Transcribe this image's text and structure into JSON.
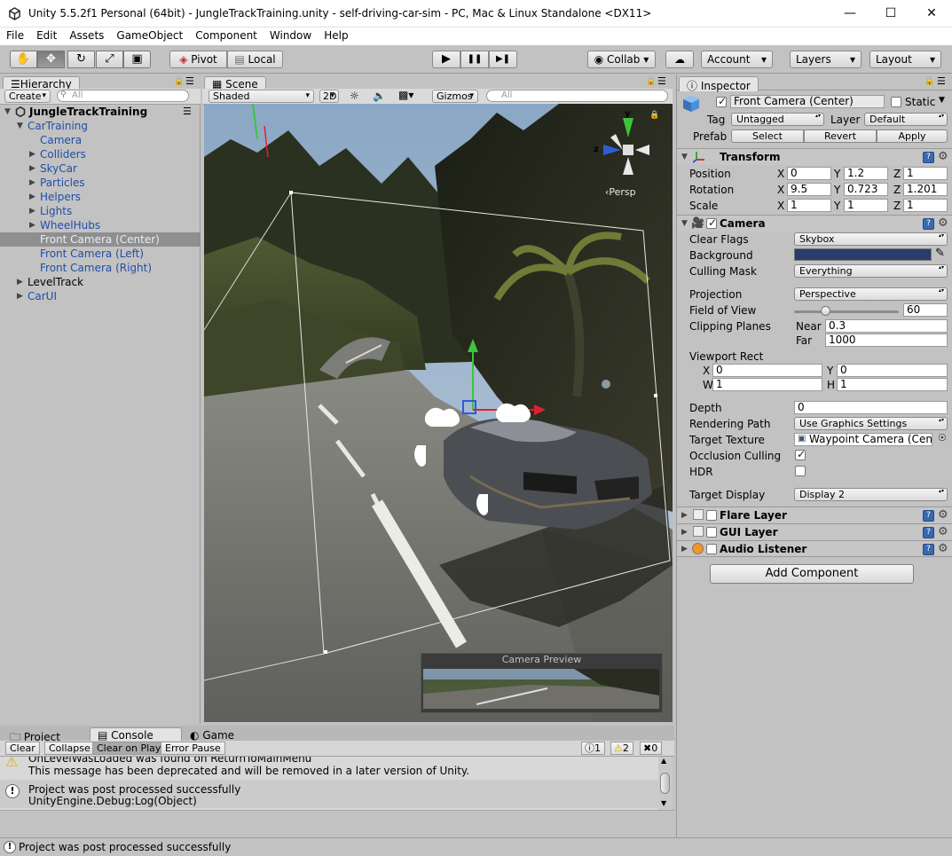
{
  "window": {
    "title": "Unity 5.5.2f1 Personal (64bit) - JungleTrackTraining.unity - self-driving-car-sim - PC, Mac & Linux Standalone <DX11>",
    "minimize": "—",
    "maximize": "☐",
    "close": "✕"
  },
  "menu": [
    "File",
    "Edit",
    "Assets",
    "GameObject",
    "Component",
    "Window",
    "Help"
  ],
  "toolbar": {
    "tools": [
      "✋",
      "✥",
      "↻",
      "⤢",
      "▣"
    ],
    "pivot": "Pivot",
    "local": "Local",
    "play": "▶",
    "pause": "❚❚",
    "step": "▶❚",
    "collab": "Collab",
    "cloud": "☁",
    "account": "Account",
    "layers": "Layers",
    "layout": "Layout"
  },
  "hierarchy": {
    "tab": "Hierarchy",
    "create": "Create",
    "search_placeholder": "All",
    "root": "JungleTrackTraining",
    "items": [
      {
        "label": "CarTraining",
        "level": 1,
        "arrow": "open",
        "blue": true
      },
      {
        "label": "Camera",
        "level": 2,
        "arrow": "none",
        "blue": true
      },
      {
        "label": "Colliders",
        "level": 2,
        "arrow": "closed",
        "blue": true
      },
      {
        "label": "SkyCar",
        "level": 2,
        "arrow": "closed",
        "blue": true
      },
      {
        "label": "Particles",
        "level": 2,
        "arrow": "closed",
        "blue": true
      },
      {
        "label": "Helpers",
        "level": 2,
        "arrow": "closed",
        "blue": true
      },
      {
        "label": "Lights",
        "level": 2,
        "arrow": "closed",
        "blue": true
      },
      {
        "label": "WheelHubs",
        "level": 2,
        "arrow": "closed",
        "blue": true
      },
      {
        "label": "Front Camera (Center)",
        "level": 2,
        "arrow": "none",
        "blue": true,
        "selected": true
      },
      {
        "label": "Front Camera (Left)",
        "level": 2,
        "arrow": "none",
        "blue": true
      },
      {
        "label": "Front Camera (Right)",
        "level": 2,
        "arrow": "none",
        "blue": true
      },
      {
        "label": "LevelTrack",
        "level": 1,
        "arrow": "closed",
        "blue": false
      },
      {
        "label": "CarUI",
        "level": 1,
        "arrow": "closed",
        "blue": true
      }
    ]
  },
  "scene": {
    "tab": "Scene",
    "shading": "Shaded",
    "mode2d": "2D",
    "gizmos": "Gizmos",
    "search_placeholder": "All",
    "persp": "‹Persp",
    "gizmo_axes": {
      "y": "y",
      "z": "z"
    },
    "camera_preview": "Camera Preview"
  },
  "inspector": {
    "tab": "Inspector",
    "object_name": "Front Camera (Center)",
    "static_label": "Static",
    "tag_label": "Tag",
    "tag_value": "Untagged",
    "layer_label": "Layer",
    "layer_value": "Default",
    "prefab_label": "Prefab",
    "prefab_buttons": [
      "Select",
      "Revert",
      "Apply"
    ],
    "transform": {
      "title": "Transform",
      "rows": [
        {
          "label": "Position",
          "x": "0",
          "y": "1.2",
          "z": "1"
        },
        {
          "label": "Rotation",
          "x": "9.5",
          "y": "0.723",
          "z": "1.201"
        },
        {
          "label": "Scale",
          "x": "1",
          "y": "1",
          "z": "1"
        }
      ]
    },
    "camera": {
      "title": "Camera",
      "clear_flags_label": "Clear Flags",
      "clear_flags": "Skybox",
      "background_label": "Background",
      "background_color": "#2a3d6a",
      "culling_mask_label": "Culling Mask",
      "culling_mask": "Everything",
      "projection_label": "Projection",
      "projection": "Perspective",
      "fov_label": "Field of View",
      "fov": "60",
      "fov_fraction": 0.3,
      "clipping_label": "Clipping Planes",
      "near_label": "Near",
      "near": "0.3",
      "far_label": "Far",
      "far": "1000",
      "viewport_label": "Viewport Rect",
      "vp_x_label": "X",
      "vp_x": "0",
      "vp_y_label": "Y",
      "vp_y": "0",
      "vp_w_label": "W",
      "vp_w": "1",
      "vp_h_label": "H",
      "vp_h": "1",
      "depth_label": "Depth",
      "depth": "0",
      "rendering_path_label": "Rendering Path",
      "rendering_path": "Use Graphics Settings",
      "target_texture_label": "Target Texture",
      "target_texture": "Waypoint Camera (Cent",
      "occlusion_label": "Occlusion Culling",
      "occlusion": true,
      "hdr_label": "HDR",
      "hdr": false,
      "target_display_label": "Target Display",
      "target_display": "Display 2"
    },
    "components": [
      "Flare Layer",
      "GUI Layer",
      "Audio Listener"
    ],
    "add_component": "Add Component"
  },
  "bottom": {
    "tabs": [
      "Project",
      "Console",
      "Game"
    ],
    "buttons": [
      "Clear",
      "Collapse",
      "Clear on Play",
      "Error Pause"
    ],
    "counts": {
      "info": "1",
      "warn": "2",
      "error": "0"
    },
    "logs": [
      {
        "type": "warning",
        "line1": "OnLevelWasLoaded was found on ReturnToMainMenu",
        "line2": "This message has been deprecated and will be removed in a later version of Unity."
      },
      {
        "type": "info",
        "line1": "Project was post processed successfully",
        "line2": "UnityEngine.Debug:Log(Object)"
      }
    ]
  },
  "status": "Project was post processed successfully"
}
